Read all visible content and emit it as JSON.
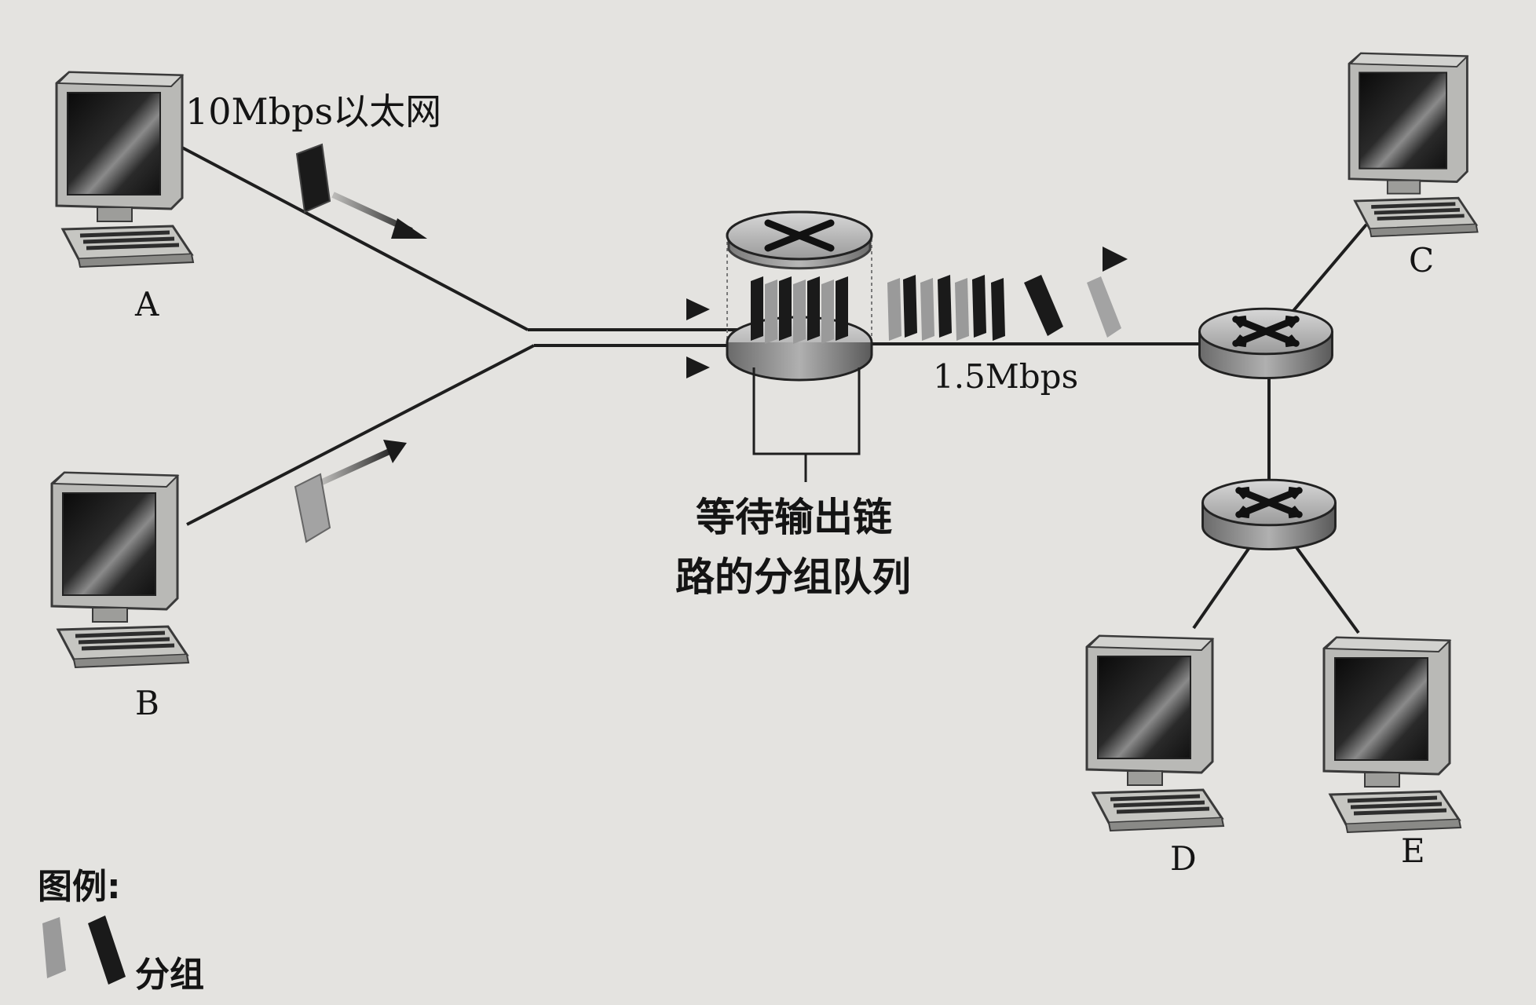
{
  "hosts": {
    "a": "A",
    "b": "B",
    "c": "C",
    "d": "D",
    "e": "E"
  },
  "links": {
    "ethernet": "10Mbps以太网",
    "bottleneck": "1.5Mbps"
  },
  "queue_caption": {
    "line1": "等待输出链",
    "line2": "路的分组队列"
  },
  "legend": {
    "title": "图例:",
    "packet": "分组"
  },
  "colors": {
    "background": "#e4e3e0",
    "line": "#1e1e1e",
    "packet_dark": "#1a1a1a",
    "packet_light": "#8c8c8c"
  }
}
